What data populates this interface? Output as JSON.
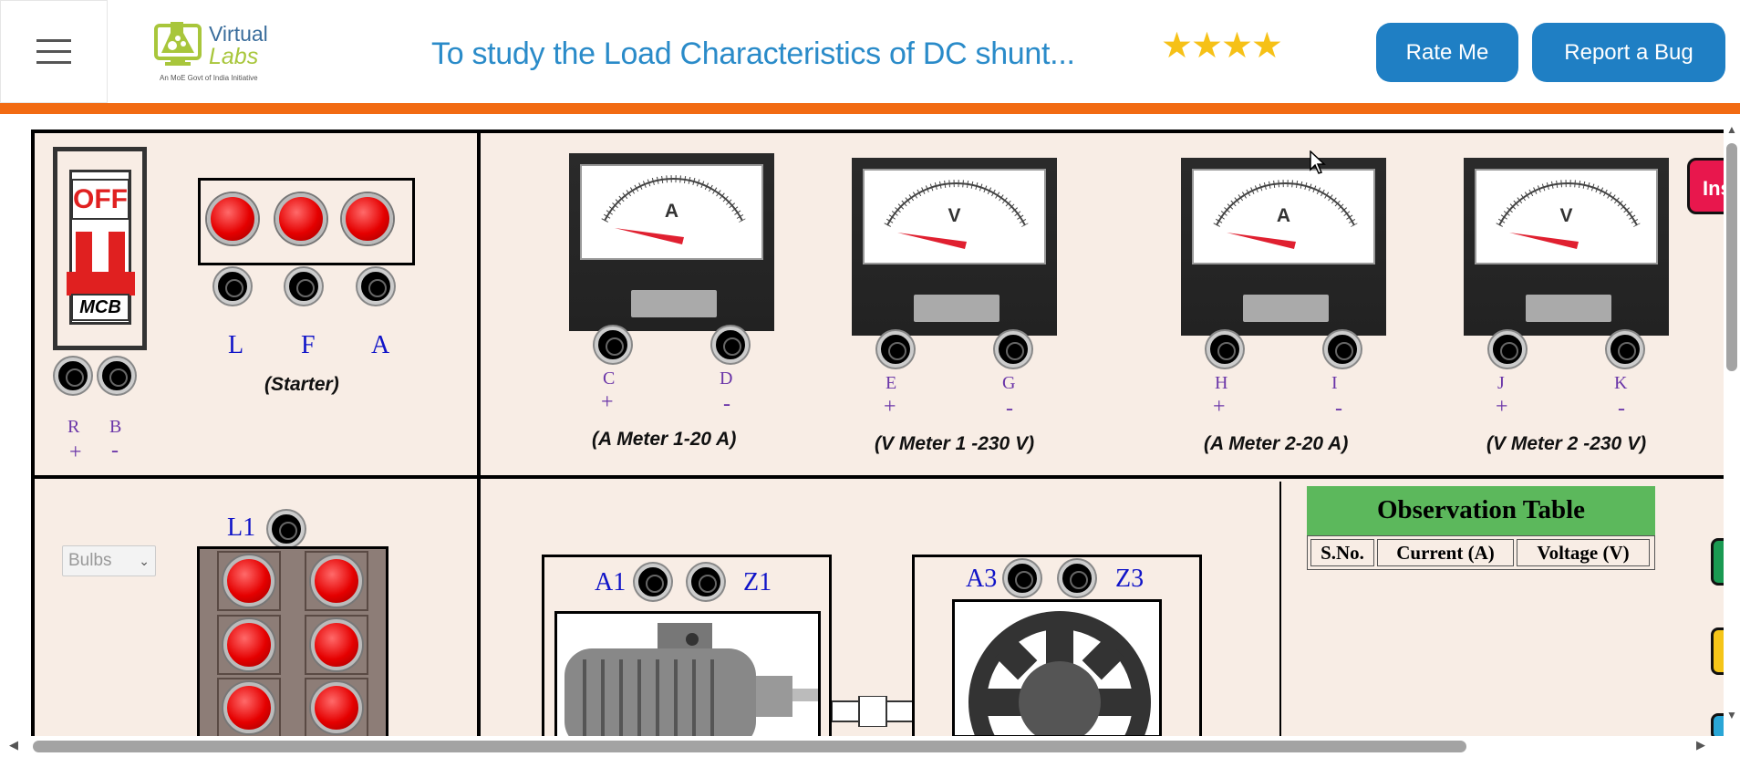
{
  "header": {
    "menu_icon": "hamburger-menu-icon",
    "logo_line1": "Virtual",
    "logo_line2": "Labs",
    "logo_tagline": "An MoE Govt of India Initiative",
    "title": "To study the Load Characteristics of DC shunt...",
    "rating": {
      "filled": 4,
      "max": 5
    },
    "rate_button": "Rate Me",
    "bug_button": "Report a Bug"
  },
  "colors": {
    "accent": "#1f7fc4",
    "orange_bar": "#f26b12",
    "panel_bg": "#f8ede5",
    "obs_header": "#5cb85c"
  },
  "supply": {
    "mcb_state": "OFF",
    "mcb_label": "MCB",
    "terminals": [
      {
        "name": "R",
        "sign": "+"
      },
      {
        "name": "B",
        "sign": "-"
      }
    ]
  },
  "starter": {
    "terminals": [
      "L",
      "F",
      "A"
    ],
    "caption": "(Starter)"
  },
  "meters": [
    {
      "type": "A",
      "t1": "C",
      "s1": "+",
      "t2": "D",
      "s2": "-",
      "caption": "(A Meter 1-20 A)"
    },
    {
      "type": "V",
      "t1": "E",
      "s1": "+",
      "t2": "G",
      "s2": "-",
      "caption": "(V Meter 1 -230 V)"
    },
    {
      "type": "A",
      "t1": "H",
      "s1": "+",
      "t2": "I",
      "s2": "-",
      "caption": "(A Meter 2-20 A)"
    },
    {
      "type": "V",
      "t1": "J",
      "s1": "+",
      "t2": "K",
      "s2": "-",
      "caption": "(V Meter 2 -230 V)"
    }
  ],
  "side_button": "Ins",
  "load": {
    "select_value": "Bulbs",
    "terminal": "L1"
  },
  "motor": {
    "t1": "A1",
    "t2": "Z1"
  },
  "generator": {
    "t1": "A3",
    "t2": "Z3"
  },
  "observation": {
    "title": "Observation Table",
    "columns": [
      "S.No.",
      "Current (A)",
      "Voltage (V)"
    ]
  }
}
